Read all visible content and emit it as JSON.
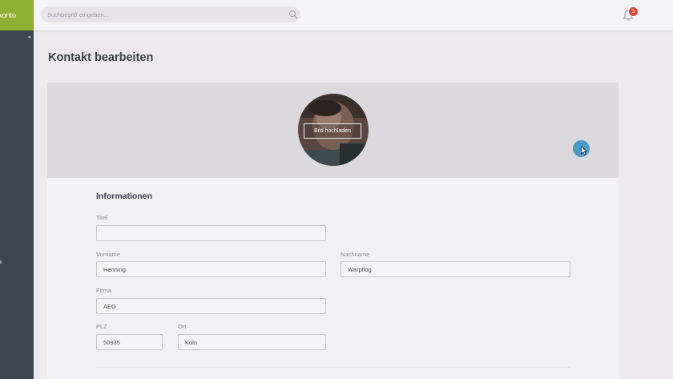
{
  "app": {
    "brand_text": "konto",
    "collapse_glyph": "◂"
  },
  "search": {
    "placeholder": "Suchbegriff eingeben...",
    "value": ""
  },
  "notifications": {
    "count": "3"
  },
  "page": {
    "title": "Kontakt bearbeiten"
  },
  "profile": {
    "upload_label": "Bild hochladen"
  },
  "form": {
    "section_title": "Informationen",
    "fields": {
      "titel": {
        "label": "Titel",
        "value": ""
      },
      "vorname": {
        "label": "Vorname",
        "value": "Henning"
      },
      "nachname": {
        "label": "Nachname",
        "value": "Warpflog"
      },
      "firma": {
        "label": "Firma",
        "value": "AEG"
      },
      "plz": {
        "label": "PLZ",
        "value": "50935"
      },
      "ort": {
        "label": "Ort",
        "value": "Koln"
      }
    }
  },
  "colors": {
    "brand": "#8eb033",
    "sidebar": "#3c4652",
    "badge": "#e0473c",
    "cursor": "#4c9ac9"
  },
  "icons": [
    "search-icon",
    "bell-icon",
    "avatar-photo",
    "cursor-arrow-icon",
    "collapse-arrow-icon"
  ]
}
